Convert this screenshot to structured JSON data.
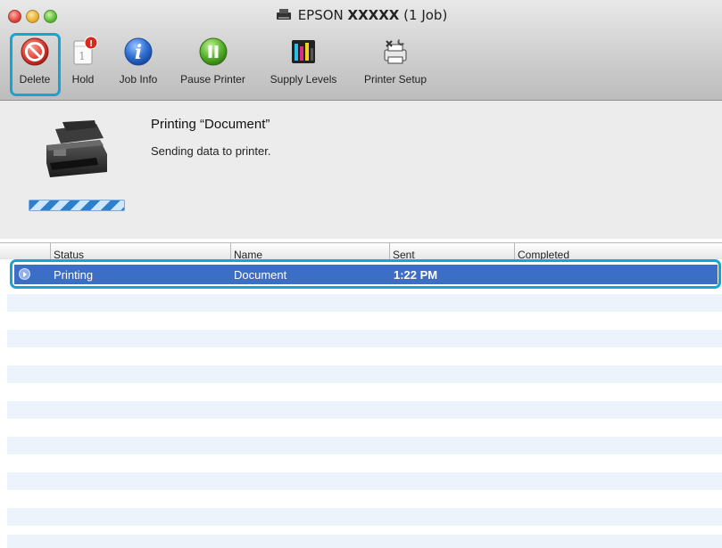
{
  "window": {
    "title_prefix": "EPSON",
    "title_model": "XXXXX",
    "title_suffix": "(1 Job)"
  },
  "toolbar": {
    "items": [
      {
        "label": "Delete",
        "icon": "delete-icon"
      },
      {
        "label": "Hold",
        "icon": "hold-icon",
        "badge": "!"
      },
      {
        "label": "Job Info",
        "icon": "info-icon"
      },
      {
        "label": "Pause Printer",
        "icon": "pause-icon"
      },
      {
        "label": "Supply Levels",
        "icon": "supply-levels-icon"
      },
      {
        "label": "Printer Setup",
        "icon": "printer-setup-icon"
      }
    ]
  },
  "status": {
    "title": "Printing “Document”",
    "subtitle": "Sending data to printer."
  },
  "table": {
    "columns": [
      "Status",
      "Name",
      "Sent",
      "Completed"
    ],
    "rows": [
      {
        "status": "Printing",
        "name": "Document",
        "sent": "1:22 PM",
        "completed": ""
      }
    ]
  },
  "colors": {
    "highlight": "#14a4d8",
    "selection": "#3d6ec5",
    "stripe": "#edf3fb"
  }
}
